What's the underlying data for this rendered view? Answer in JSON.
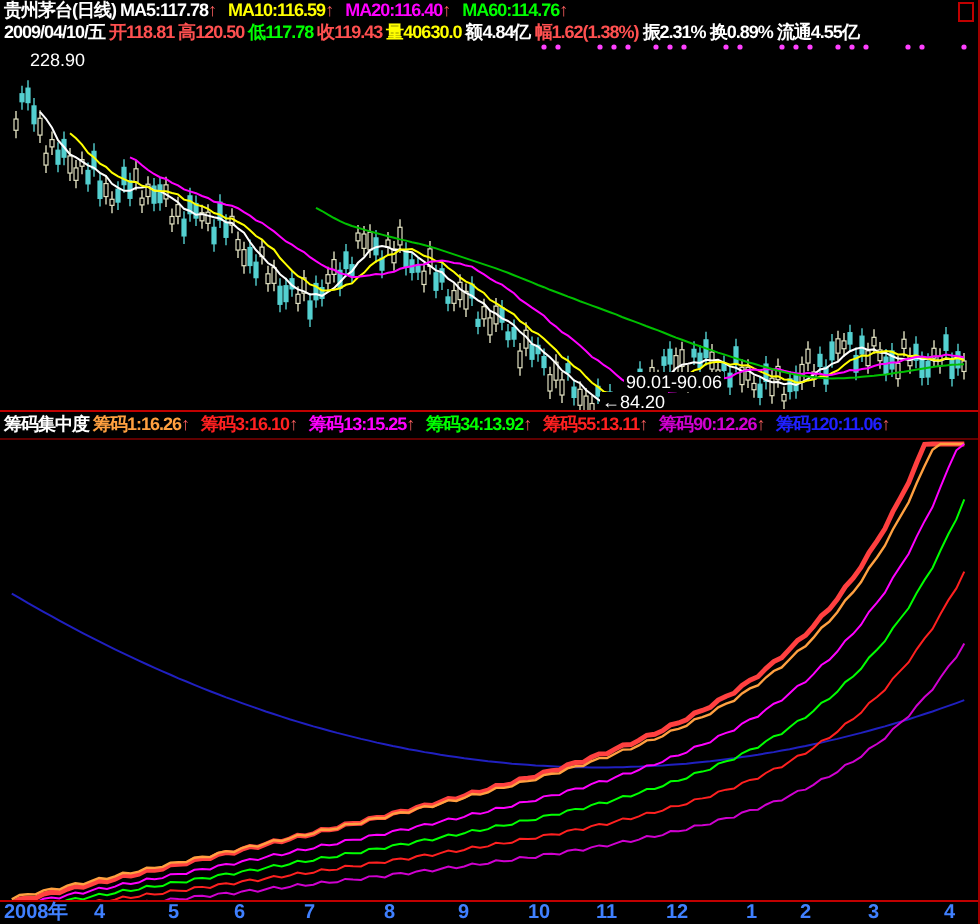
{
  "header": {
    "title": "贵州茅台(日线)",
    "moving_averages": [
      {
        "text": "MA5:117.78",
        "arrow": "↑",
        "color": "#ffffff"
      },
      {
        "text": "MA10:116.59",
        "arrow": "↑",
        "color": "#ffff00"
      },
      {
        "text": "MA20:116.40",
        "arrow": "↑",
        "color": "#ff00ff"
      },
      {
        "text": "MA60:114.76",
        "arrow": "↑",
        "color": "#00ff00"
      }
    ],
    "quote": [
      {
        "text": "2009/04/10/五",
        "color": "#ffffff"
      },
      {
        "text": "开118.81",
        "color": "#ff5050"
      },
      {
        "text": "高120.50",
        "color": "#ff5050"
      },
      {
        "text": "低117.78",
        "color": "#00ff00"
      },
      {
        "text": "收119.43",
        "color": "#ff5050"
      },
      {
        "text": "量40630.0",
        "color": "#ffff00"
      },
      {
        "text": "额4.84亿",
        "color": "#ffffff"
      },
      {
        "text": "幅1.62(1.38%)",
        "color": "#ff5050"
      },
      {
        "text": "振2.31%",
        "color": "#ffffff"
      },
      {
        "text": "换0.89%",
        "color": "#ffffff"
      },
      {
        "text": "流通4.55亿",
        "color": "#ffffff"
      }
    ]
  },
  "price_labels": {
    "high": "228.90",
    "low_range": "90.01-90.06",
    "low": "←84.20"
  },
  "indicator": {
    "title": "筹码集中度",
    "values": [
      {
        "text": "筹码1:16.26",
        "arrow": "↑",
        "color": "#ffa040"
      },
      {
        "text": "筹码3:16.10",
        "arrow": "↑",
        "color": "#ff2020"
      },
      {
        "text": "筹码13:15.25",
        "arrow": "↑",
        "color": "#ff00ff"
      },
      {
        "text": "筹码34:13.92",
        "arrow": "↑",
        "color": "#00ff00"
      },
      {
        "text": "筹码55:13.11",
        "arrow": "↑",
        "color": "#ff2020"
      },
      {
        "text": "筹码90:12.26",
        "arrow": "↑",
        "color": "#d000d0"
      },
      {
        "text": "筹码120:11.06",
        "arrow": "↑",
        "color": "#2020ff"
      }
    ]
  },
  "time_axis": [
    "2008年",
    "4",
    "5",
    "6",
    "7",
    "8",
    "9",
    "10",
    "11",
    "12",
    "1",
    "2",
    "3",
    "4"
  ]
}
